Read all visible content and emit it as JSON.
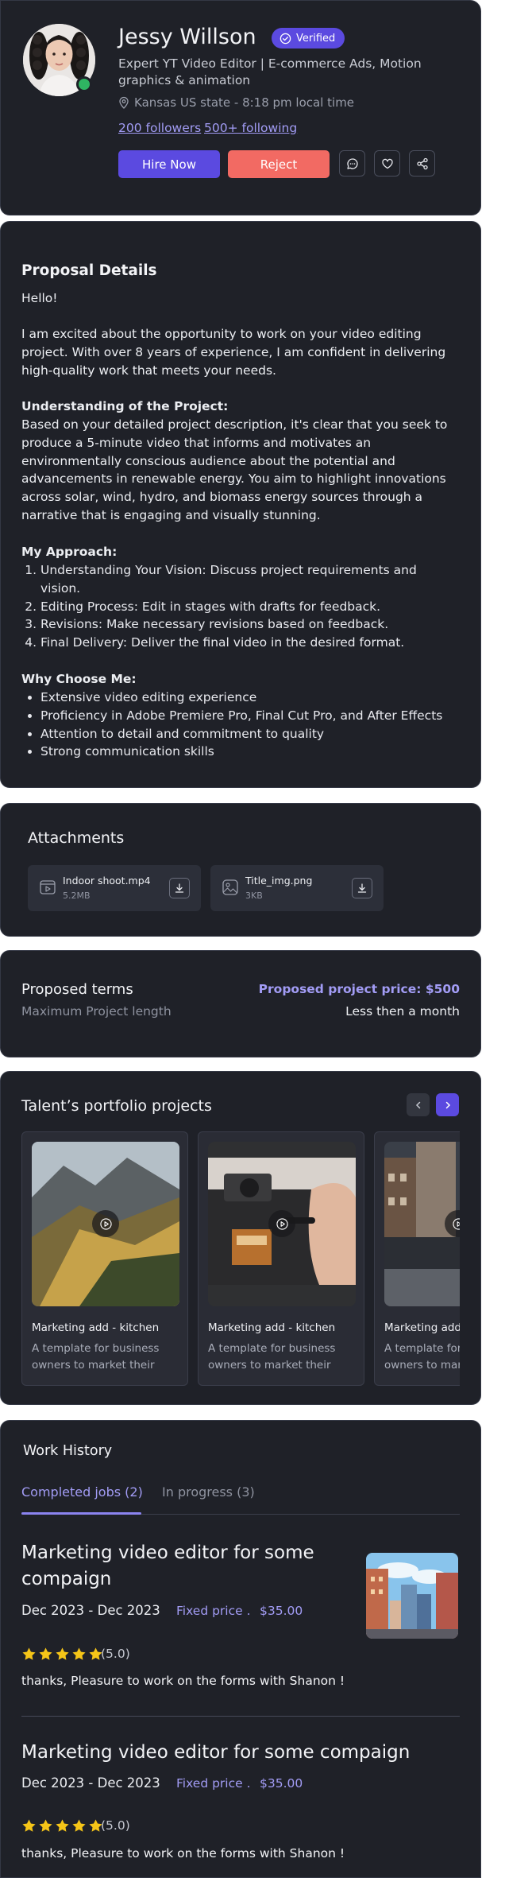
{
  "profile": {
    "name": "Jessy Willson",
    "verified_label": "Verified",
    "headline": "Expert YT Video Editor | E-commerce Ads, Motion graphics & animation",
    "location": "Kansas US state - 8:18 pm local time",
    "followers": "200 followers",
    "following": "500+ following",
    "hire_label": "Hire Now",
    "reject_label": "Reject",
    "colors": {
      "hire": "#5b4ae0",
      "reject": "#f26a63",
      "online": "#2fb562"
    }
  },
  "proposal": {
    "title": "Proposal Details",
    "greeting": "Hello!",
    "intro": "I am excited about the opportunity to work on your video editing project. With over 8 years of experience, I am confident in delivering high-quality work that meets your needs.",
    "understanding_heading": "Understanding of the Project:",
    "understanding_text": "Based on your detailed project description, it's clear that you seek to produce a 5-minute video that informs and motivates an environmentally conscious audience about the potential and advancements in renewable energy. You aim to highlight innovations across solar, wind, hydro, and biomass energy sources through a narrative that is engaging and visually stunning.",
    "approach_heading": "My Approach:",
    "approach_items": [
      "Understanding Your Vision: Discuss project requirements and vision.",
      "Editing Process: Edit in stages with drafts for feedback.",
      "Revisions: Make necessary revisions based on feedback.",
      "Final Delivery: Deliver the final video in the desired format."
    ],
    "why_heading": "Why Choose Me:",
    "why_items": [
      "Extensive video editing experience",
      "Proficiency in Adobe Premiere Pro, Final Cut Pro, and After Effects",
      "Attention to detail and commitment to quality",
      "Strong communication skills"
    ]
  },
  "attachments": {
    "title": "Attachments",
    "files": [
      {
        "name": "Indoor shoot.mp4",
        "size": "5.2MB",
        "icon": "video-file-icon"
      },
      {
        "name": "Title_img.png",
        "size": "3KB",
        "icon": "image-file-icon"
      }
    ]
  },
  "terms": {
    "title": "Proposed terms",
    "price": "Proposed project price: $500",
    "length_label": "Maximum Project length",
    "length_value": "Less then a month"
  },
  "portfolio": {
    "title": "Talent’s portfolio projects",
    "items": [
      {
        "name": "Marketing add - kitchen",
        "desc": "A template for business owners to market their new products"
      },
      {
        "name": "Marketing add - kitchen",
        "desc": "A template for business owners to market their new products"
      },
      {
        "name": "Marketing add - kitchen",
        "desc": "A template for business owners to market their new products"
      }
    ]
  },
  "history": {
    "title": "Work History",
    "tabs": [
      {
        "label": "Completed jobs (2)",
        "active": true
      },
      {
        "label": "In progress (3)",
        "active": false
      }
    ],
    "jobs": [
      {
        "title": "Marketing video editor for some compaign",
        "dates": "Dec 2023 - Dec 2023",
        "price_type": "Fixed price .",
        "price": "$35.00",
        "rating": "(5.0)",
        "stars": 5,
        "review": "thanks, Pleasure to work on the forms with Shanon !"
      },
      {
        "title": "Marketing video editor for some compaign",
        "dates": "Dec 2023 - Dec 2023",
        "price_type": "Fixed price .",
        "price": "$35.00",
        "rating": "(5.0)",
        "stars": 5,
        "review": "thanks, Pleasure to work on the forms with Shanon !"
      }
    ]
  }
}
